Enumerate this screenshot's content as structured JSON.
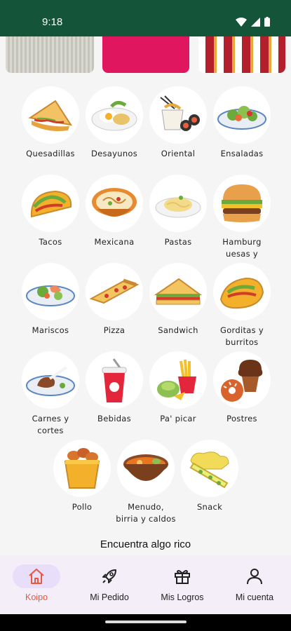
{
  "status": {
    "time": "9:18"
  },
  "categories": [
    {
      "label": "Quesadillas",
      "icon": "quesadilla-icon"
    },
    {
      "label": "Desayunos",
      "icon": "breakfast-icon"
    },
    {
      "label": "Oriental",
      "icon": "oriental-icon"
    },
    {
      "label": "Ensaladas",
      "icon": "salad-icon"
    },
    {
      "label": "Tacos",
      "icon": "taco-icon"
    },
    {
      "label": "Mexicana",
      "icon": "mexican-icon"
    },
    {
      "label": "Pastas",
      "icon": "pasta-icon"
    },
    {
      "label": "Hamburg\nuesas y",
      "icon": "burger-icon"
    },
    {
      "label": "Mariscos",
      "icon": "seafood-icon"
    },
    {
      "label": "Pizza",
      "icon": "pizza-icon"
    },
    {
      "label": "Sandwich",
      "icon": "sandwich-icon"
    },
    {
      "label": "Gorditas y\nburritos",
      "icon": "burrito-icon"
    },
    {
      "label": "Carnes y\ncortes",
      "icon": "meat-icon"
    },
    {
      "label": "Bebidas",
      "icon": "drink-icon"
    },
    {
      "label": "Pa' picar",
      "icon": "snack-plate-icon"
    },
    {
      "label": "Postres",
      "icon": "dessert-icon"
    },
    {
      "label": "Pollo",
      "icon": "chicken-icon"
    },
    {
      "label": "Menudo,\nbirria y caldos",
      "icon": "soup-icon"
    },
    {
      "label": "Snack",
      "icon": "chips-icon"
    }
  ],
  "headline": "Encuentra algo rico",
  "nav": {
    "items": [
      {
        "label": "Koipo",
        "icon": "home-icon",
        "active": true
      },
      {
        "label": "Mi Pedido",
        "icon": "rocket-icon",
        "active": false
      },
      {
        "label": "Mis Logros",
        "icon": "gift-icon",
        "active": false
      },
      {
        "label": "Mi cuenta",
        "icon": "user-icon",
        "active": false
      }
    ]
  },
  "colors": {
    "status_bar": "#14553a",
    "accent": "#e8593c",
    "banner_pink": "#e0175f"
  }
}
